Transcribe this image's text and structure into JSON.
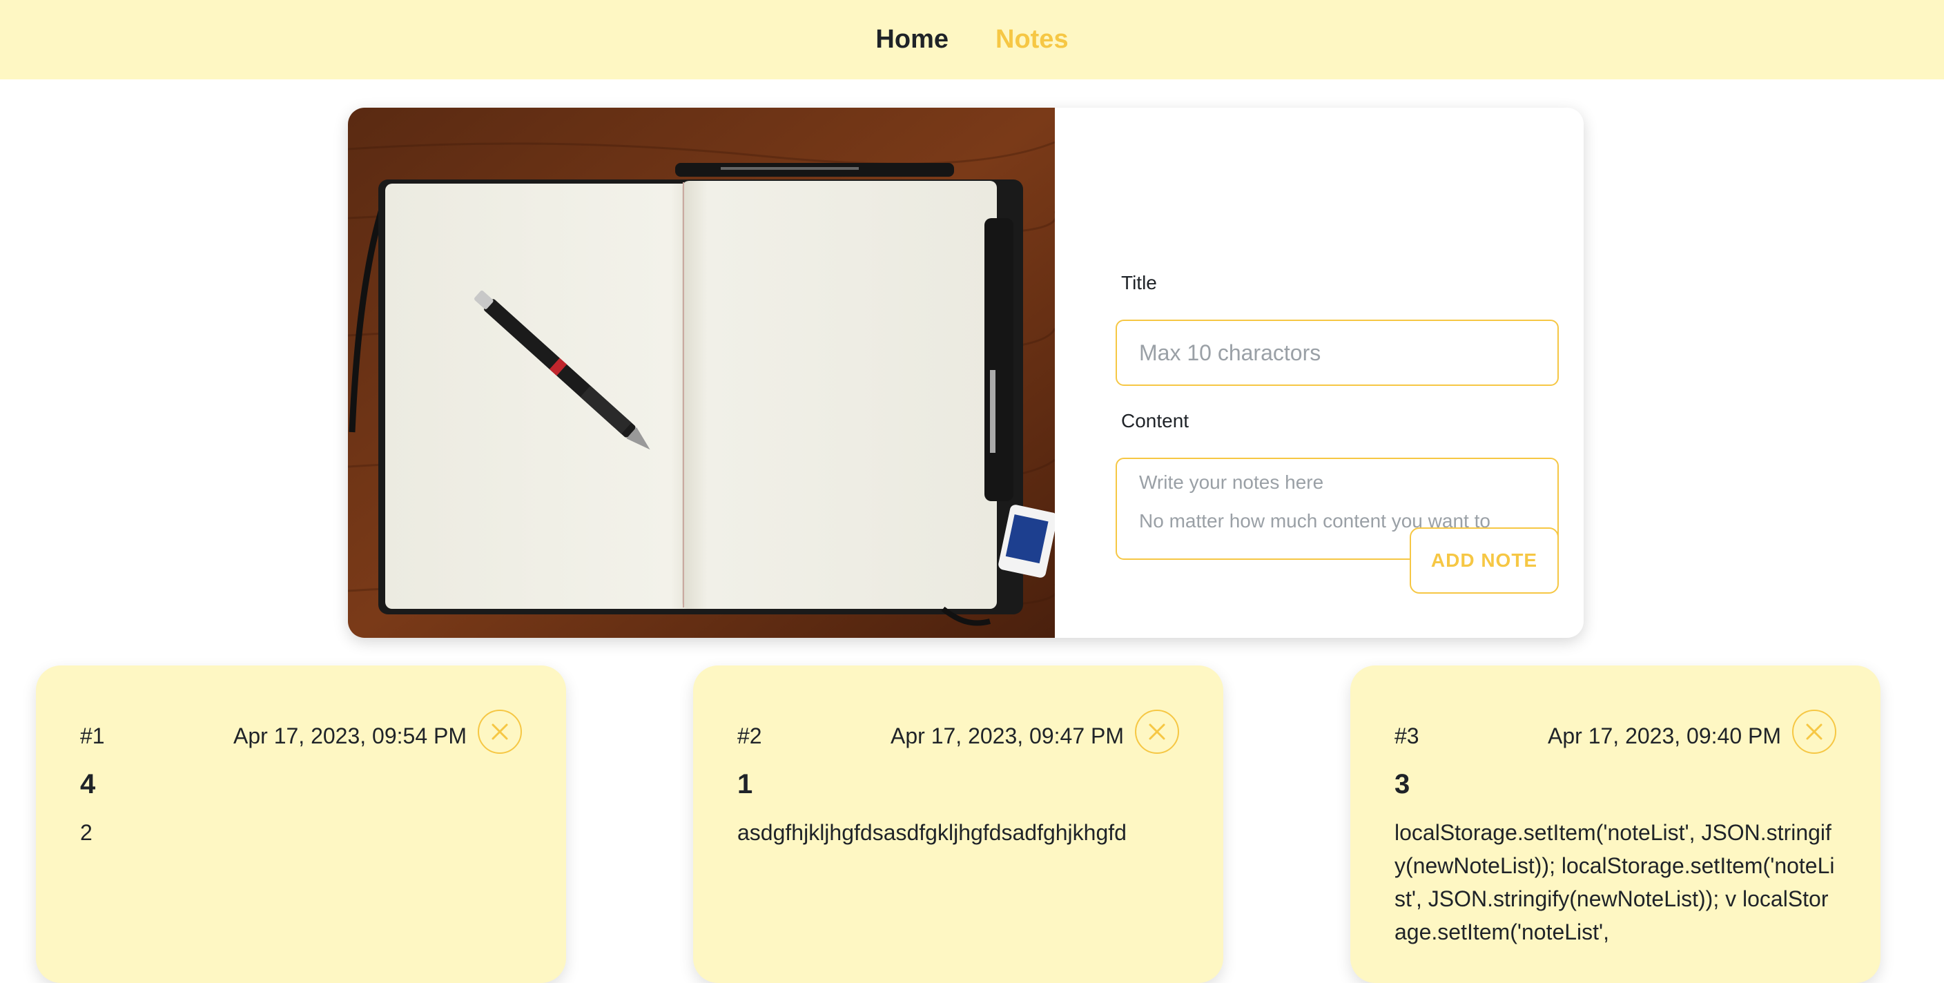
{
  "nav": {
    "home_label": "Home",
    "notes_label": "Notes",
    "active": "notes",
    "active_color": "#f6c744"
  },
  "composer": {
    "hero_image": "open-notebook-with-pencil-photo",
    "title_label": "Title",
    "title_placeholder": "Max 10 charactors",
    "content_label": "Content",
    "content_placeholder": "Write your notes here\nNo matter how much content you want to",
    "add_button_label": "ADD NOTE"
  },
  "notes": [
    {
      "index": "#1",
      "date": "Apr 17, 2023, 09:54 PM",
      "title": "4",
      "body": "2",
      "close_icon": "close-icon"
    },
    {
      "index": "#2",
      "date": "Apr 17, 2023, 09:47 PM",
      "title": "1",
      "body": "asdgfhjkljhgfdsasdfgkljhgfdsadfghjkhgfd",
      "close_icon": "close-icon"
    },
    {
      "index": "#3",
      "date": "Apr 17, 2023, 09:40 PM",
      "title": "3",
      "body": "localStorage.setItem('noteList', JSON.stringify(newNoteList)); localStorage.setItem('noteList', JSON.stringify(newNoteList)); v localStorage.setItem('noteList',",
      "close_icon": "close-icon"
    }
  ],
  "colors": {
    "accent": "#f6c744",
    "card_bg": "#fef7c3",
    "text": "#1f2328"
  }
}
